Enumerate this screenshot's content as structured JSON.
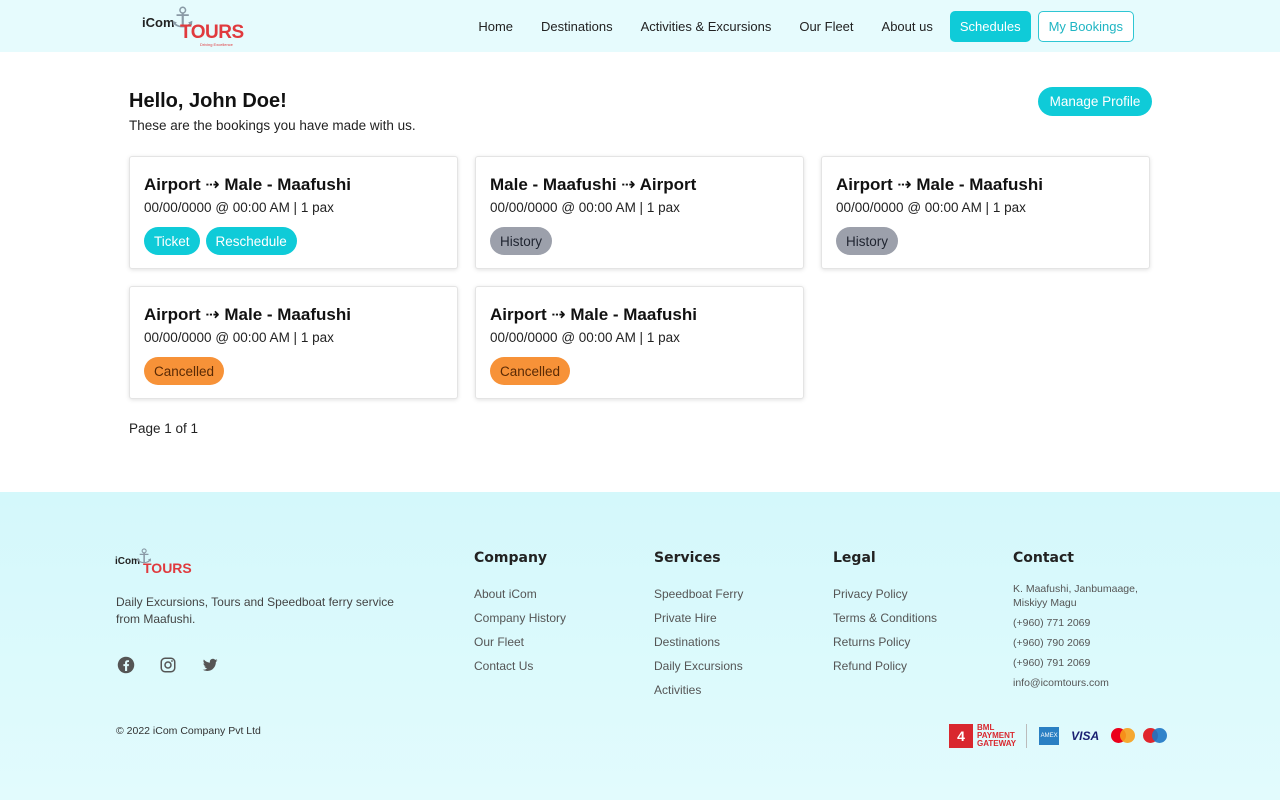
{
  "brand": {
    "logo_prefix": "iCom",
    "logo_main": "TOURS",
    "logo_tagline": "Driving Excellence"
  },
  "nav": {
    "items": [
      "Home",
      "Destinations",
      "Activities & Excursions",
      "Our Fleet",
      "About us"
    ],
    "schedules_label": "Schedules",
    "bookings_label": "My Bookings"
  },
  "main": {
    "greeting": "Hello, John Doe!",
    "subtitle": "These are the bookings you have made with us.",
    "manage_profile_label": "Manage Profile",
    "bookings": [
      {
        "route": "Airport ⇢ Male - Maafushi",
        "meta": "00/00/0000 @ 00:00 AM | 1 pax",
        "actions": [
          "Ticket",
          "Reschedule"
        ]
      },
      {
        "route": "Male - Maafushi ⇢ Airport",
        "meta": "00/00/0000 @ 00:00 AM | 1 pax",
        "actions": [
          "History"
        ]
      },
      {
        "route": "Airport ⇢ Male - Maafushi",
        "meta": "00/00/0000 @ 00:00 AM | 1 pax",
        "actions": [
          "History"
        ]
      },
      {
        "route": "Airport ⇢ Male - Maafushi",
        "meta": "00/00/0000 @ 00:00 AM | 1 pax",
        "actions": [
          "Cancelled"
        ]
      },
      {
        "route": "Airport ⇢ Male - Maafushi",
        "meta": "00/00/0000 @ 00:00 AM | 1 pax",
        "actions": [
          "Cancelled"
        ]
      }
    ],
    "pagination": "Page 1 of 1"
  },
  "footer": {
    "description": "Daily Excursions, Tours and Speedboat ferry service from Maafushi.",
    "social_icons": [
      "facebook-icon",
      "instagram-icon",
      "twitter-icon"
    ],
    "copyright": "© 2022 iCom Company Pvt Ltd",
    "company": {
      "title": "Company",
      "links": [
        "About iCom",
        "Company History",
        "Our Fleet",
        "Contact Us"
      ]
    },
    "services": {
      "title": "Services",
      "links": [
        "Speedboat Ferry",
        "Private Hire",
        "Destinations",
        "Daily Excursions",
        "Activities"
      ]
    },
    "legal": {
      "title": "Legal",
      "links": [
        "Privacy Policy",
        "Terms & Conditions",
        "Returns Policy",
        "Refund Policy"
      ]
    },
    "contact": {
      "title": "Contact",
      "lines": [
        "K. Maafushi, Janbumaage, Miskiyy Magu",
        "(+960) 771 2069",
        "(+960) 790 2069",
        "(+960) 791 2069",
        "info@icomtours.com"
      ]
    },
    "payment": {
      "bml_line1": "BML",
      "bml_line2": "PAYMENT",
      "bml_line3": "GATEWAY",
      "amex": "AMEX",
      "visa": "VISA"
    }
  },
  "colors": {
    "accent": "#0fcbd8",
    "history": "#9ca0ab",
    "cancelled": "#f79238",
    "header_bg": "#e6fbfd",
    "footer_bg": "#d4f8fb"
  }
}
